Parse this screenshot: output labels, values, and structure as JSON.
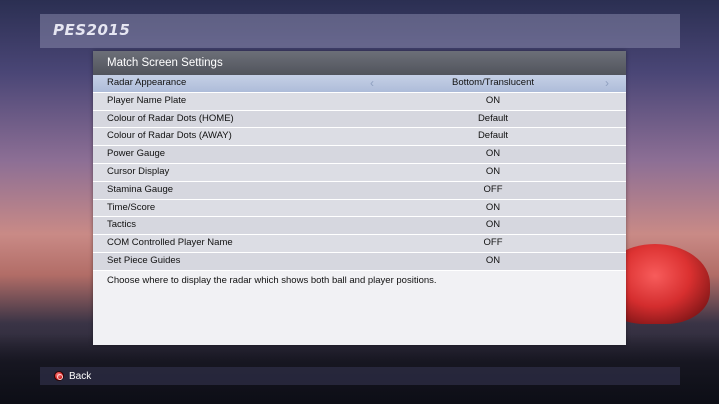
{
  "app": {
    "logo": "PES2015"
  },
  "panel": {
    "title": "Match Screen Settings",
    "rows": [
      {
        "label": "Radar Appearance",
        "value": "Bottom/Translucent"
      },
      {
        "label": "Player Name Plate",
        "value": "ON"
      },
      {
        "label": "Colour of Radar Dots (HOME)",
        "value": "Default"
      },
      {
        "label": "Colour of Radar Dots (AWAY)",
        "value": "Default"
      },
      {
        "label": "Power Gauge",
        "value": "ON"
      },
      {
        "label": "Cursor Display",
        "value": "ON"
      },
      {
        "label": "Stamina Gauge",
        "value": "OFF"
      },
      {
        "label": "Time/Score",
        "value": "ON"
      },
      {
        "label": "Tactics",
        "value": "ON"
      },
      {
        "label": "COM Controlled Player Name",
        "value": "OFF"
      },
      {
        "label": "Set Piece Guides",
        "value": "ON"
      }
    ],
    "help_text": "Choose where to display the radar which shows both ball and player positions.",
    "selector_left": "‹",
    "selector_right": "›"
  },
  "footer": {
    "back_label": "Back",
    "back_icon": "circle-button-icon"
  },
  "colors": {
    "accent": "#aebcd9",
    "header": "#5c5f67",
    "back_button": "#d11c1c"
  }
}
